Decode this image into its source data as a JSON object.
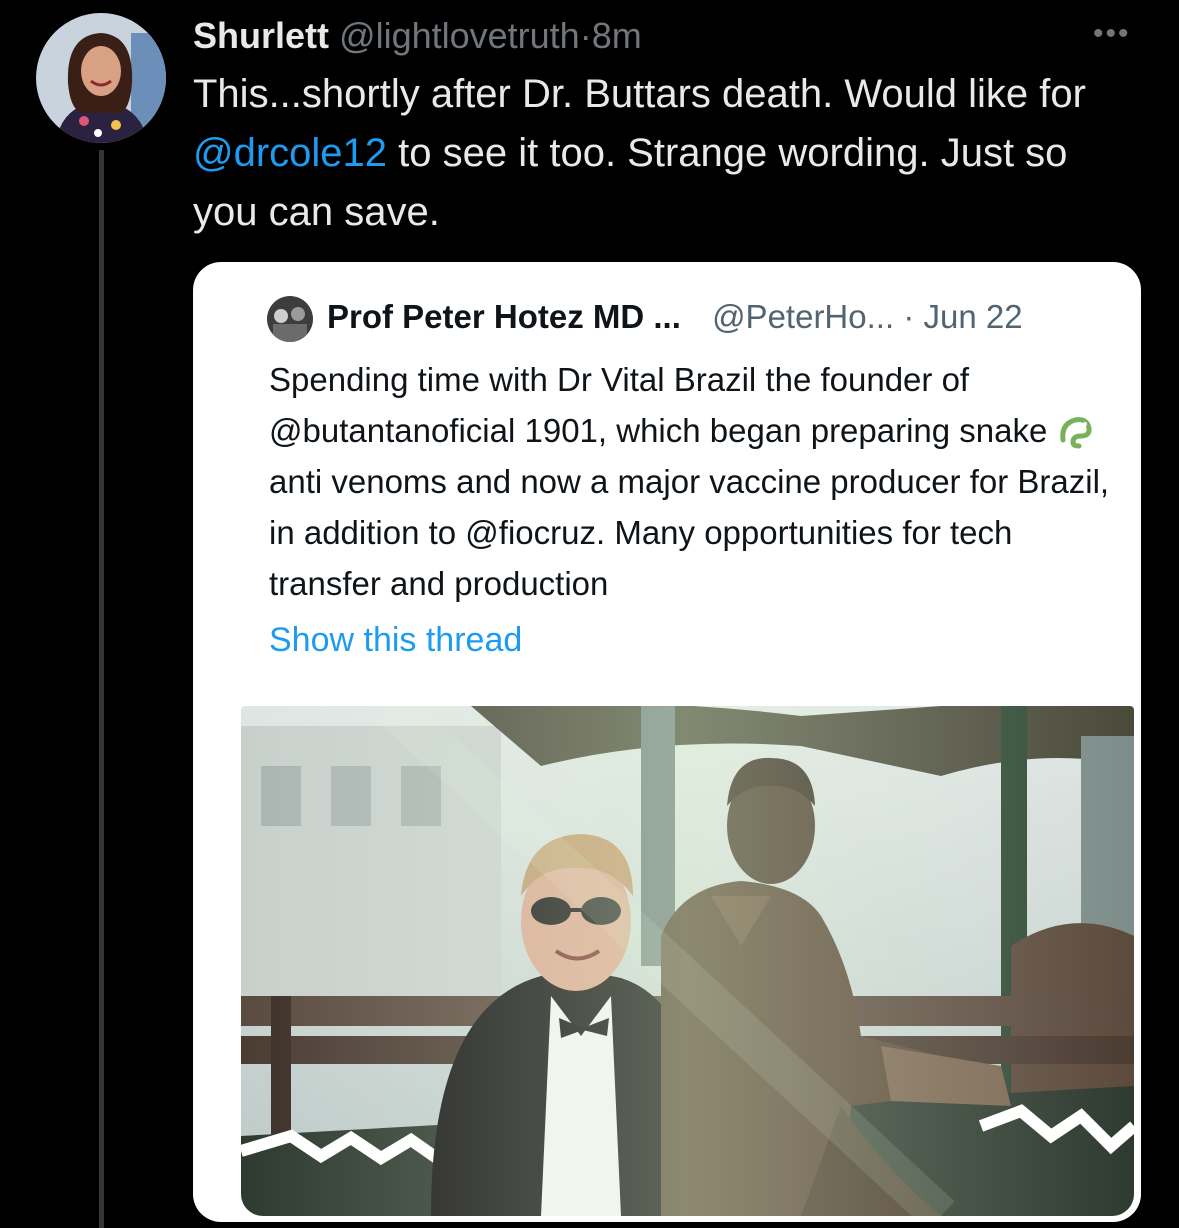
{
  "tweet": {
    "author_name": "Shurlett",
    "author_handle": "@lightlovetruth",
    "separator": "·",
    "time": "8m",
    "more_icon": "more-horizontal-icon",
    "text_before": "This...shortly after Dr. Buttars death. Would like for ",
    "mention": "@drcole12",
    "text_after": " to see it too.  Strange wording. Just so you can save."
  },
  "quoted_tweet": {
    "author_name": "Prof Peter Hotez MD ...",
    "author_handle": "@PeterHo...",
    "separator": "·",
    "date": "Jun 22",
    "text_before": "Spending time with Dr Vital Brazil the founder of @butantanoficial 1901, which began preparing snake ",
    "emoji": "snake-emoji",
    "text_after": " anti venoms and now a major vaccine producer for Brazil, in addition to @fiocruz. Many opportunities for tech transfer and production",
    "show_thread": "Show this thread"
  },
  "colors": {
    "background": "#000000",
    "text_primary": "#e7e9ea",
    "text_secondary": "#71767b",
    "link": "#1d9bf0",
    "card": "#ffffff"
  }
}
